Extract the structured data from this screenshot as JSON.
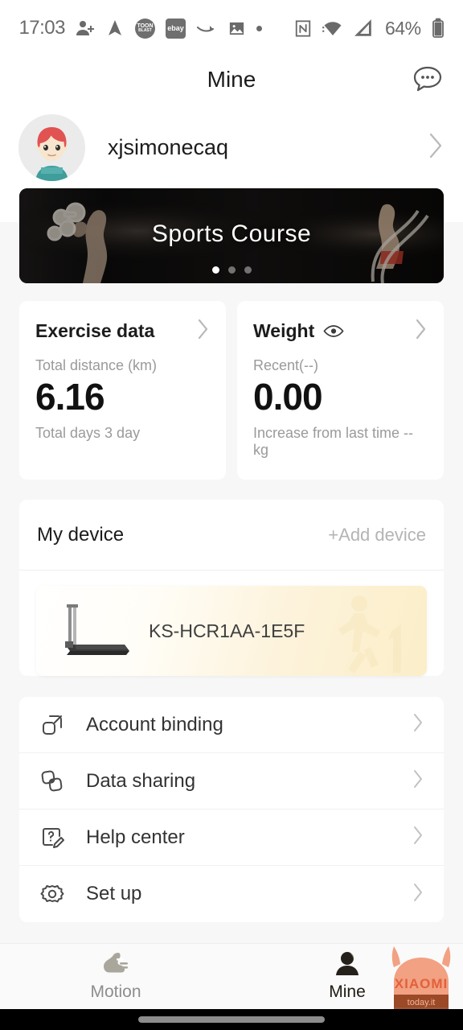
{
  "statusbar": {
    "time": "17:03",
    "icons": [
      "contact-add-icon",
      "navigation-arrow-icon",
      "toon-blast-icon",
      "ebay-icon",
      "amazon-icon",
      "photo-icon",
      "dot-icon",
      "nfc-icon",
      "wifi-icon",
      "signal-icon"
    ],
    "toon_label_top": "TOON",
    "toon_label_bottom": "BLAST",
    "ebay_label": "ebay",
    "battery_percent": "64%"
  },
  "header": {
    "title": "Mine",
    "message_icon": "chat-bubble-icon"
  },
  "profile": {
    "username": "xjsimonecaq",
    "chevron": "chevron-right-icon"
  },
  "banner": {
    "title": "Sports Course",
    "dots": 3,
    "active_dot": 0
  },
  "cards": [
    {
      "title": "Exercise data",
      "has_eye": false,
      "sub": "Total distance (km)",
      "value": "6.16",
      "foot": "Total days  3  day"
    },
    {
      "title": "Weight",
      "has_eye": true,
      "sub": "Recent(--)",
      "value": "0.00",
      "foot": "Increase from last time --kg"
    }
  ],
  "device": {
    "section_title": "My device",
    "add_label": "+Add device",
    "name": "KS-HCR1AA-1E5F",
    "device_icon": "treadmill-icon",
    "watermark_icon": "running-person-icon"
  },
  "menu": [
    {
      "icon": "link-squares-icon",
      "label": "Account binding"
    },
    {
      "icon": "data-share-icon",
      "label": "Data sharing"
    },
    {
      "icon": "help-edit-icon",
      "label": "Help center"
    },
    {
      "icon": "gear-icon",
      "label": "Set up"
    }
  ],
  "tabs": [
    {
      "icon": "running-shoe-icon",
      "label": "Motion",
      "active": false
    },
    {
      "icon": "person-icon",
      "label": "Mine",
      "active": true
    }
  ],
  "watermark": {
    "brand": "XIAOMI",
    "site": "today.it"
  },
  "colors": {
    "page_bg": "#f7f7f7",
    "card_bg": "#ffffff",
    "text_primary": "#1c1c1c",
    "text_muted": "#9a9a9a",
    "banner_bg": "#121212",
    "device_accent": "#fbeec8",
    "watermark": "#f2a183"
  }
}
